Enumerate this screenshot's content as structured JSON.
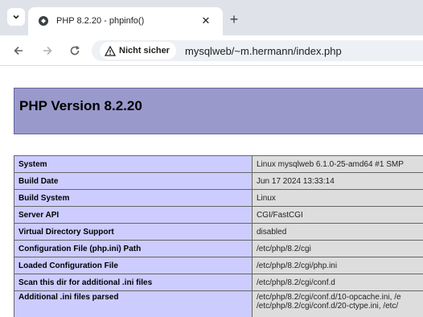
{
  "browser": {
    "tab": {
      "title": "PHP 8.2.20 - phpinfo()"
    },
    "security_chip": "Nicht sicher",
    "url": "mysqlweb/~m.hermann/index.php"
  },
  "page": {
    "title": "PHP Version 8.2.20",
    "rows": [
      {
        "label": "System",
        "value": "Linux mysqlweb 6.1.0-25-amd64 #1 SMP"
      },
      {
        "label": "Build Date",
        "value": "Jun 17 2024 13:33:14"
      },
      {
        "label": "Build System",
        "value": "Linux"
      },
      {
        "label": "Server API",
        "value": "CGI/FastCGI"
      },
      {
        "label": "Virtual Directory Support",
        "value": "disabled"
      },
      {
        "label": "Configuration File (php.ini) Path",
        "value": "/etc/php/8.2/cgi"
      },
      {
        "label": "Loaded Configuration File",
        "value": "/etc/php/8.2/cgi/php.ini"
      },
      {
        "label": "Scan this dir for additional .ini files",
        "value": "/etc/php/8.2/cgi/conf.d"
      },
      {
        "label": "Additional .ini files parsed",
        "value": "/etc/php/8.2/cgi/conf.d/10-opcache.ini, /e",
        "value2": "/etc/php/8.2/cgi/conf.d/20-ctype.ini, /etc/"
      }
    ]
  },
  "colors": {
    "header_bg": "#9999cc",
    "label_bg": "#ccccff",
    "value_bg": "#dddddd"
  }
}
